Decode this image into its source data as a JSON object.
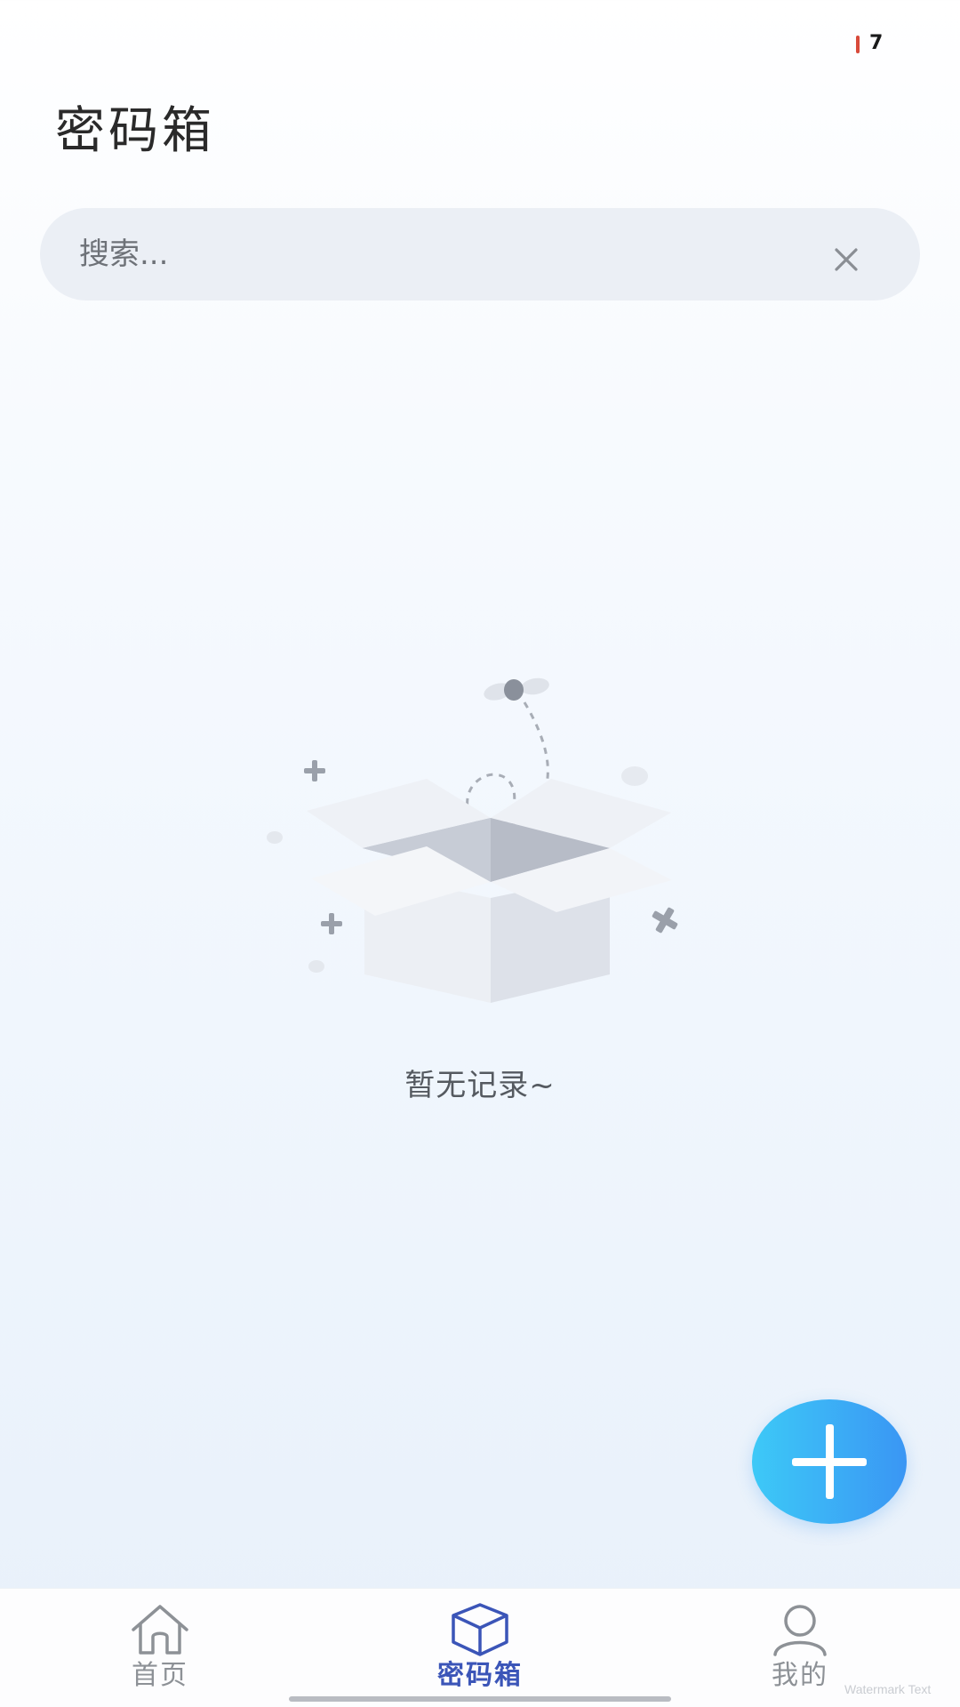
{
  "status_bar": {
    "battery": "7"
  },
  "header": {
    "title": "密码箱"
  },
  "search": {
    "placeholder": "搜索...",
    "value": ""
  },
  "empty_state": {
    "message": "暂无记录~"
  },
  "fab": {
    "icon": "plus-icon"
  },
  "tab_bar": {
    "active": "密码箱",
    "tabs": [
      {
        "label": "首页",
        "icon": "home-icon"
      },
      {
        "label": "密码箱",
        "icon": "box-icon"
      },
      {
        "label": "我的",
        "icon": "user-icon"
      }
    ]
  },
  "watermark": "Watermark Text",
  "colors": {
    "accent": "#3b55b8",
    "fab_start": "#3dc9f7",
    "fab_end": "#3a96f4",
    "status_indicator": "#d84a3a"
  }
}
